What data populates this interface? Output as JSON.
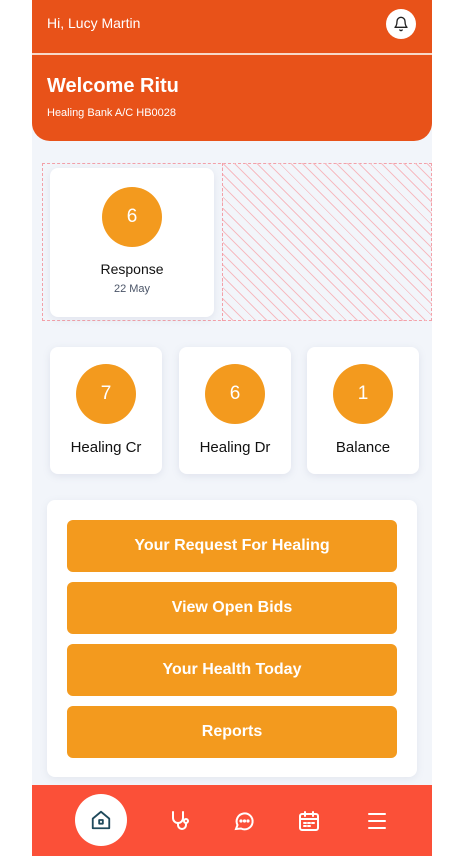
{
  "header": {
    "greeting": "Hi, Lucy Martin",
    "bell_icon": "bell-icon"
  },
  "welcome": {
    "title": "Welcome Ritu",
    "account": "Healing Bank A/C HB0028"
  },
  "response": {
    "count": "6",
    "label": "Response",
    "date": "22 May"
  },
  "stats": [
    {
      "value": "7",
      "label": "Healing Cr"
    },
    {
      "value": "6",
      "label": "Healing Dr"
    },
    {
      "value": "1",
      "label": "Balance"
    }
  ],
  "actions": [
    {
      "label": "Your Request For Healing"
    },
    {
      "label": "View Open Bids"
    },
    {
      "label": "Your Health Today"
    },
    {
      "label": "Reports"
    }
  ],
  "nav": {
    "items": [
      "home-icon",
      "stethoscope-icon",
      "chat-icon",
      "calendar-icon",
      "menu-icon"
    ]
  },
  "colors": {
    "header": "#e85219",
    "accent": "#f39a1e",
    "nav": "#fb5038"
  }
}
